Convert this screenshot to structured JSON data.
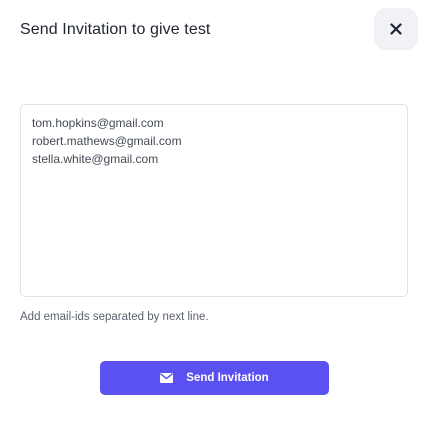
{
  "dialog": {
    "title": "Send Invitation to give test",
    "close_icon": "close-icon"
  },
  "emails": {
    "value": "tom.hopkins@gmail.com\nrobert.mathews@gmail.com\nstella.white@gmail.com",
    "helper": "Add email-ids separated by next line."
  },
  "send_button": {
    "label": "Send Invitation",
    "icon": "envelope-icon"
  },
  "colors": {
    "primary": "#5b50f0",
    "close_bg": "#f1f2f5",
    "border": "#dfe2e8"
  }
}
